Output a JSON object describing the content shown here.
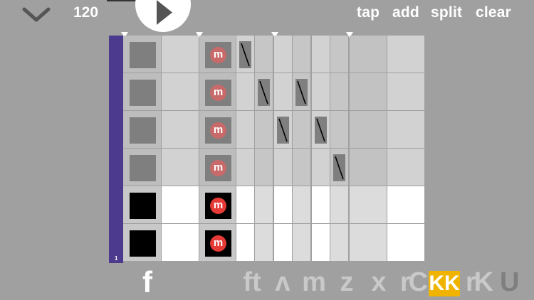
{
  "header": {
    "tempo": "120",
    "actions": {
      "tap": "tap",
      "add": "add",
      "split": "split",
      "clear": "clear"
    }
  },
  "grid": {
    "pattern_number": "1",
    "mute_glyph": "m",
    "rows": [
      {
        "active": false,
        "notes": [
          0
        ]
      },
      {
        "active": false,
        "notes": [
          1,
          3
        ]
      },
      {
        "active": false,
        "notes": [
          2,
          4
        ]
      },
      {
        "active": false,
        "notes": [
          5
        ]
      },
      {
        "active": true,
        "notes": []
      },
      {
        "active": true,
        "notes": []
      }
    ]
  },
  "toolbar": {
    "f": "f",
    "ft": "ft",
    "up": "ʌ",
    "m": "m",
    "z": "z",
    "x": "x",
    "rc": "rC",
    "kk": "KK",
    "rk": "rK",
    "u": "U"
  },
  "colors": {
    "background": "#a0a0a0",
    "sidebar": "#4b3a8e",
    "accent": "#f0b400",
    "mute_active": "#e53a36"
  },
  "icons": {
    "menu": "chevron-down-icon",
    "play": "play-icon",
    "mute": "mute-icon"
  }
}
